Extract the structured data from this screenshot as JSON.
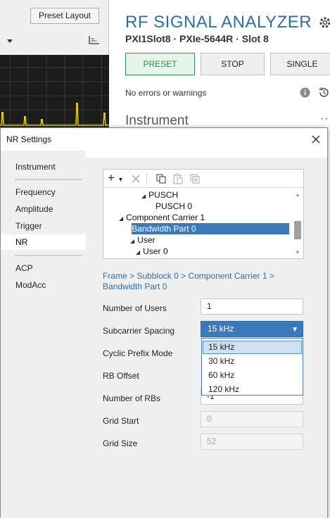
{
  "background": {
    "preset_layout_label": "Preset Layout",
    "app_title": "RF SIGNAL ANALYZER",
    "device_line": "PXI1Slot8 · PXIe-5644R · Slot 8",
    "buttons": {
      "preset": "PRESET",
      "stop": "STOP",
      "single": "SINGLE"
    },
    "status": "No errors or warnings",
    "section_heading": "Instrument",
    "more_label": "···"
  },
  "dialog": {
    "title": "NR Settings",
    "nav": {
      "items": [
        "Instrument",
        "Frequency",
        "Amplitude",
        "Trigger",
        "NR",
        "ACP",
        "ModAcc"
      ],
      "selected": "NR"
    },
    "tree": {
      "toolbar": {
        "add_label": "+",
        "add_menu_arrow": "▾"
      },
      "rows": [
        {
          "label": "PUSCH",
          "expander": "◢"
        },
        {
          "label": "PUSCH 0",
          "expander": ""
        },
        {
          "label": "Component Carrier 1",
          "expander": "◢"
        },
        {
          "label": "Bandwidth Part 0",
          "expander": "◢"
        },
        {
          "label": "User",
          "expander": "◢"
        },
        {
          "label": "User 0",
          "expander": "◢"
        }
      ],
      "selected_row": "Bandwidth Part 0"
    },
    "breadcrumb": {
      "parts": [
        "Frame",
        "Subblock 0",
        "Component Carrier 1",
        "Bandwidth Part 0"
      ],
      "separator": ">"
    },
    "properties": {
      "number_of_users": {
        "label": "Number of Users",
        "value": "1"
      },
      "subcarrier_spacing": {
        "label": "Subcarrier Spacing",
        "value": "15 kHz",
        "options": [
          "15 kHz",
          "30 kHz",
          "60 kHz",
          "120 kHz"
        ],
        "highlighted": "15 kHz"
      },
      "cyclic_prefix_mode": {
        "label": "Cyclic Prefix Mode"
      },
      "rb_offset": {
        "label": "RB Offset"
      },
      "number_of_rbs": {
        "label": "Number of RBs",
        "value": "-1"
      },
      "grid_start": {
        "label": "Grid Start",
        "value": "0"
      },
      "grid_size": {
        "label": "Grid Size",
        "value": "52"
      }
    }
  },
  "colors": {
    "accent_blue": "#3c79b8",
    "title_blue": "#2d6ea8",
    "preset_green": "#2e8b57",
    "plot_bg": "#1b1b1b",
    "trace_yellow": "#e6d200"
  }
}
